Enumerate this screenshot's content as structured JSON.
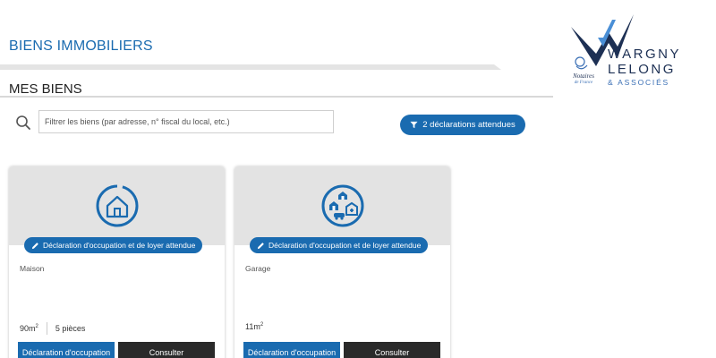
{
  "header": {
    "page_title": "BIENS IMMOBILIERS",
    "section_title": "MES BIENS"
  },
  "search": {
    "placeholder": "Filtrer les biens (par adresse, n° fiscal du local, etc.)",
    "icon": "search-icon"
  },
  "filter": {
    "label": "2 déclarations attendues",
    "icon": "funnel-icon"
  },
  "logo": {
    "line1": "WARGNY",
    "line2": "LELONG",
    "line3": "& ASSOCIÉS",
    "notaires": "Notaires",
    "de_france": "de France"
  },
  "properties": [
    {
      "icon": "house-icon",
      "status": "Déclaration d'occupation et de loyer attendue",
      "type": "Maison",
      "area": "90m",
      "area_sup": "2",
      "rooms": "5 pièces",
      "declaration_button": "Déclaration d'occupation",
      "consult_button": "Consulter"
    },
    {
      "icon": "garage-icon",
      "status": "Déclaration d'occupation et de loyer attendue",
      "type": "Garage",
      "area": "11m",
      "area_sup": "2",
      "rooms": "",
      "declaration_button": "Déclaration d'occupation",
      "consult_button": "Consulter"
    }
  ],
  "colors": {
    "accent": "#1a6bb0",
    "dark_button": "#2a2a2a",
    "card_header": "#e3e3e3"
  }
}
